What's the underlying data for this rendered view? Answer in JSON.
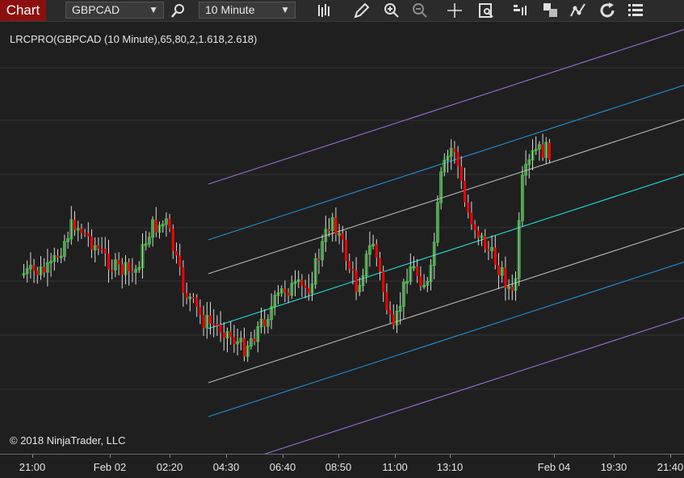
{
  "toolbar": {
    "chart_tab": "Chart",
    "instrument": "GBPCAD",
    "interval": "10 Minute",
    "icons": [
      "search-icon",
      "bar-type-icon",
      "pencil-icon",
      "zoom-in-icon",
      "zoom-out-icon",
      "crosshair-icon",
      "data-box-icon",
      "chart-trader-icon",
      "window-linking-icon",
      "drawing-tools-icon",
      "refresh-icon",
      "properties-icon"
    ]
  },
  "chart": {
    "indicator_label": "LRCPRO(GBPCAD (10 Minute),65,80,2,1.618,2.618)",
    "copyright": "© 2018 NinjaTrader, LLC",
    "colors": {
      "background": "#1f1f1f",
      "grid": "#333333",
      "up_candle": "#32cd32",
      "down_candle": "#ff0000",
      "wick": "#d8d8d8",
      "center_line": "#20dede",
      "inner_band": "#b8b8b8",
      "middle_band": "#1e8fd6",
      "outer_band": "#9b6bd8"
    }
  },
  "time_axis": {
    "labels": [
      "21:00",
      "Feb 02",
      "02:20",
      "04:30",
      "06:40",
      "08:50",
      "11:00",
      "13:10",
      "Feb 04",
      "19:30",
      "21:40"
    ]
  }
}
